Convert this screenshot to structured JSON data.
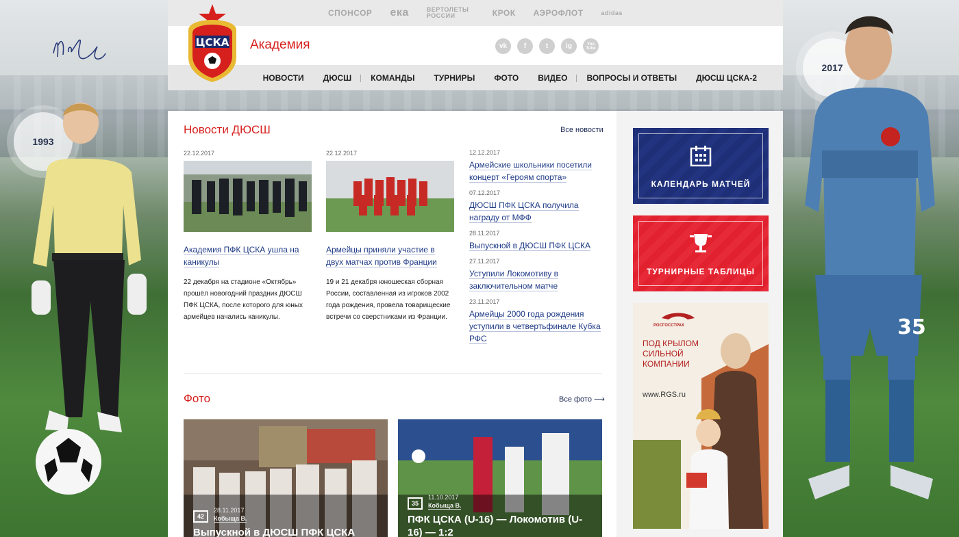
{
  "sponsors": [
    "СПОНСОР",
    "ека",
    "ВЕРТОЛЕТЫ РОССИИ",
    "КРОК",
    "АЭРОФЛОТ",
    "adidas"
  ],
  "header": {
    "section_title": "Академия",
    "logo_text": "ЦСКА",
    "socials": [
      "vk",
      "f",
      "t",
      "ig",
      "You Tube"
    ]
  },
  "nav": [
    "НОВОСТИ",
    "ДЮСШ",
    "КОМАНДЫ",
    "ТУРНИРЫ",
    "ФОТО",
    "ВИДЕО",
    "ВОПРОСЫ И ОТВЕТЫ",
    "ДЮСШ ЦСКА-2"
  ],
  "years": {
    "left": "1993",
    "right": "2017"
  },
  "news": {
    "title": "Новости ДЮСШ",
    "all_link": "Все новости",
    "cards": [
      {
        "date": "22.12.2017",
        "title": "Академия ПФК ЦСКА ушла на каникулы",
        "text": "22 декабря на стадионе «Октябрь» прошёл новогодний праздник ДЮСШ ПФК ЦСКА, после которого для юных армейцев начались каникулы."
      },
      {
        "date": "22.12.2017",
        "title": "Армейцы приняли участие в двух матчах против Франции",
        "text": "19 и 21 декабря юношеская сборная России, составленная из игроков 2002 года рождения, провела товарищеские встречи со сверстниками из Франции."
      }
    ],
    "list": [
      {
        "date": "12.12.2017",
        "title": "Армейские школьники посетили концерт «Героям спорта»"
      },
      {
        "date": "07.12.2017",
        "title": "ДЮСШ ПФК ЦСКА получила награду от МФФ"
      },
      {
        "date": "28.11.2017",
        "title": "Выпускной в ДЮСШ ПФК ЦСКА"
      },
      {
        "date": "27.11.2017",
        "title": "Уступили Локомотиву в заключительном матче"
      },
      {
        "date": "23.11.2017",
        "title": "Армейцы 2000 года рождения уступили в четвертьфинале Кубка РФС"
      }
    ]
  },
  "photos": {
    "title": "Фото",
    "all_link": "Все фото",
    "items": [
      {
        "count": "42",
        "date": "28.11.2017",
        "author": "Кобыща В.",
        "title": "Выпускной в ДЮСШ ПФК ЦСКА"
      },
      {
        "count": "35",
        "date": "11.10.2017",
        "author": "Кобыща В.",
        "title": "ПФК ЦСКА (U-16) — Локомотив (U-16) — 1:2"
      }
    ]
  },
  "sidebar": {
    "calendar": "КАЛЕНДАРЬ МАТЧЕЙ",
    "tables": "ТУРНИРНЫЕ ТАБЛИЦЫ",
    "ad": {
      "brand": "РОСГОССТРАХ",
      "text": "ПОД КРЫЛОМ СИЛЬНОЙ КОМПАНИИ",
      "url": "www.RGS.ru"
    }
  },
  "colors": {
    "accent": "#d6201d",
    "navy": "#1a2a6c",
    "link": "#1e3a86"
  }
}
